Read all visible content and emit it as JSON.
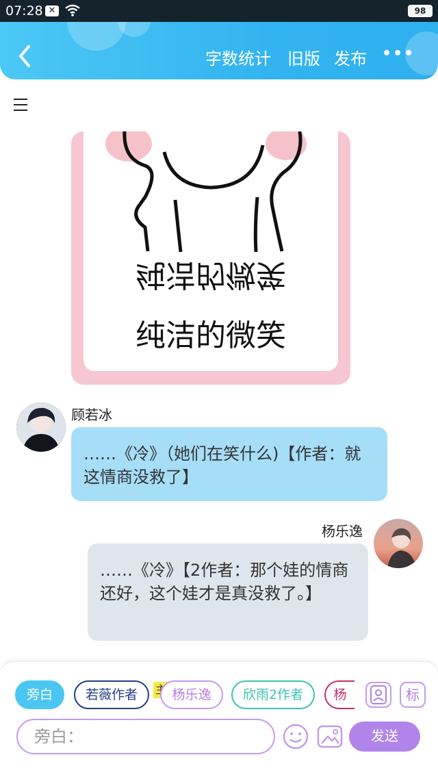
{
  "status": {
    "time": "07:28",
    "battery": "98"
  },
  "header": {
    "links": [
      "字数统计",
      "旧版",
      "发布"
    ],
    "more": "•••"
  },
  "image_card": {
    "caption_mirrored": "纯洁的微笑",
    "caption": "纯洁的微笑"
  },
  "messages": [
    {
      "author": "顾若冰",
      "text": "……《冷》（她们在笑什么)【作者：就这情商没救了】",
      "side": "left"
    },
    {
      "author": "杨乐逸",
      "text": "……《冷》【2作者：那个娃的情商还好，这个娃才是真没救了。】",
      "side": "right"
    }
  ],
  "roles": [
    {
      "label": "旁白",
      "color": "#4bc6f2",
      "active": true
    },
    {
      "label": "若薇作者",
      "color": "#233f86",
      "active": false
    },
    {
      "label": "杨乐逸",
      "color": "#c49bea",
      "active": false
    },
    {
      "label": "欣雨2作者",
      "color": "#3bc4b4",
      "active": false
    },
    {
      "label": "杨",
      "color": "#c4306b",
      "active": false
    }
  ],
  "main_tag": "主",
  "side_buttons": {
    "person_icon": "person-icon",
    "mark": "标"
  },
  "composer": {
    "placeholder": "旁白：",
    "send": "发送"
  }
}
